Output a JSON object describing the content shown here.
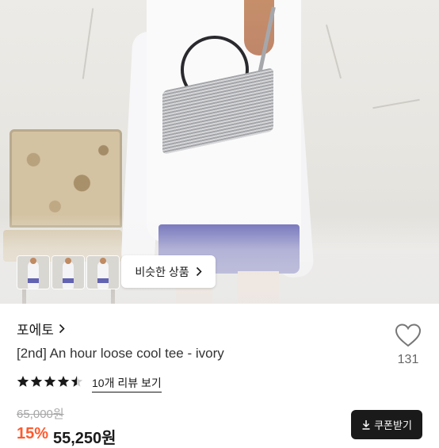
{
  "gallery": {
    "similar_button_label": "비슷한 상품",
    "thumbnail_count": 3
  },
  "product": {
    "shop_name": "포에토",
    "title": "[2nd] An hour loose cool tee - ivory",
    "likes": "131",
    "rating": 4.5,
    "review_link": "10개 리뷰 보기",
    "original_price": "65,000원",
    "discount": "15%",
    "price": "55,250원",
    "coupon_label": "쿠폰받기"
  },
  "colors": {
    "discount": "#ff5a2d",
    "coupon_bg": "#1a1a1a",
    "star": "#1a1a1a"
  },
  "icons": {
    "shop_chevron": "chevron-right-icon",
    "like": "heart-outline-icon",
    "coupon": "download-icon"
  }
}
